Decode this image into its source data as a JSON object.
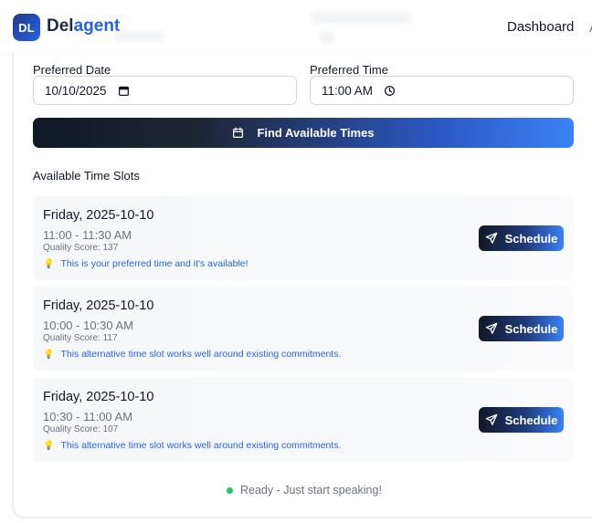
{
  "app": {
    "logo_initials": "DL",
    "brand_part1": "Del",
    "brand_part2": "agent",
    "nav_dashboard": "Dashboard",
    "nav_cut": "A"
  },
  "form": {
    "date_label": "Preferred Date",
    "date_value": "10/10/2025",
    "time_label": "Preferred Time",
    "time_value": "11:00 AM",
    "find_button": "Find Available Times"
  },
  "slots_title": "Available Time Slots",
  "slots": [
    {
      "date": "Friday, 2025-10-10",
      "time": "11:00 - 11:30 AM",
      "score": "Quality Score: 137",
      "note": "This is your preferred time and it's available!",
      "button": "Schedule"
    },
    {
      "date": "Friday, 2025-10-10",
      "time": "10:00 - 10:30 AM",
      "score": "Quality Score: 117",
      "note": "This alternative time slot works well around existing commitments.",
      "button": "Schedule"
    },
    {
      "date": "Friday, 2025-10-10",
      "time": "10:30 - 11:00 AM",
      "score": "Quality Score: 107",
      "note": "This alternative time slot works well around existing commitments.",
      "button": "Schedule"
    }
  ],
  "status": {
    "text": "Ready - Just start speaking!",
    "color": "#22c55e"
  },
  "colors": {
    "accent": "#2563eb",
    "dark": "#111827"
  },
  "icons": {
    "date_input": "calendar-icon",
    "time_input": "clock-icon",
    "find_button": "calendar-icon",
    "note": "lightbulb-icon",
    "schedule": "send-icon"
  }
}
